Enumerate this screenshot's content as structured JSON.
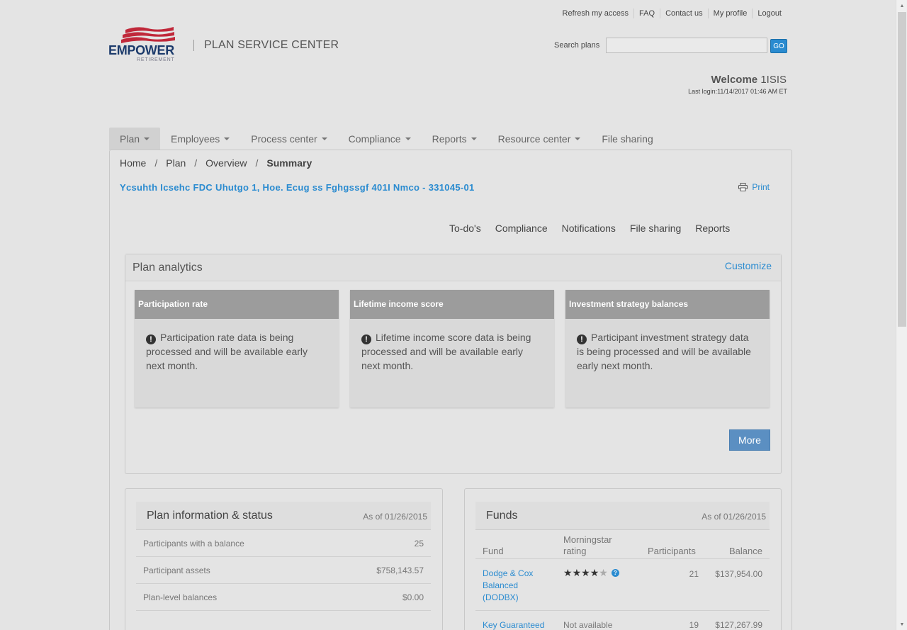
{
  "utility": {
    "links": [
      "Refresh my access",
      "FAQ",
      "Contact us",
      "My profile",
      "Logout"
    ]
  },
  "brand": {
    "wordmark": "EMPOWER",
    "sub": "RETIREMENT",
    "app_title": "PLAN SERVICE CENTER",
    "colors": {
      "navy": "#1b3a6b",
      "red": "#c0283a",
      "accent": "#2a8bd0"
    }
  },
  "search": {
    "label": "Search plans",
    "value": "",
    "button": "GO"
  },
  "welcome": {
    "greeting": "Welcome",
    "user": "1ISIS",
    "last_login": "Last login:11/14/2017 01:46 AM ET"
  },
  "nav": {
    "items": [
      {
        "label": "Plan",
        "dropdown": true
      },
      {
        "label": "Employees",
        "dropdown": true
      },
      {
        "label": "Process center",
        "dropdown": true
      },
      {
        "label": "Compliance",
        "dropdown": true
      },
      {
        "label": "Reports",
        "dropdown": true
      },
      {
        "label": "Resource center",
        "dropdown": true
      },
      {
        "label": "File sharing",
        "dropdown": false
      }
    ]
  },
  "breadcrumb": [
    "Home",
    "Plan",
    "Overview",
    "Summary"
  ],
  "plan_title": "Ycsuhth Icsehc FDC Uhutgo 1, Hoe. Ecug ss Fghgssgf 401I Nmco - 331045-01",
  "print_label": "Print",
  "subtabs": [
    "To-do's",
    "Compliance",
    "Notifications",
    "File sharing",
    "Reports"
  ],
  "analytics": {
    "title": "Plan analytics",
    "customize": "Customize",
    "cards": [
      {
        "title": "Participation rate",
        "body": "Participation rate data is being processed and will be available early next month."
      },
      {
        "title": "Lifetime income score",
        "body": "Lifetime income score data is being processed and will be available early next month."
      },
      {
        "title": "Investment strategy balances",
        "body": "Participant investment strategy data is being processed and will be available early next month."
      }
    ],
    "more": "More"
  },
  "plan_info": {
    "title": "Plan information & status",
    "as_of": "As of 01/26/2015",
    "rows": [
      {
        "label": "Participants with a balance",
        "value": "25"
      },
      {
        "label": "Participant assets",
        "value": "$758,143.57"
      },
      {
        "label": "Plan-level balances",
        "value": "$0.00"
      }
    ]
  },
  "funds": {
    "title": "Funds",
    "as_of": "As of 01/26/2015",
    "headers": {
      "fund": "Fund",
      "rating": "Morningstar rating",
      "participants": "Participants",
      "balance": "Balance"
    },
    "rows": [
      {
        "name": "Dodge & Cox Balanced (DODBX)",
        "rating": 4,
        "rating_max": 5,
        "rating_text": "",
        "participants": "21",
        "balance": "$137,954.00"
      },
      {
        "name": "Key Guaranteed",
        "rating": null,
        "rating_max": 5,
        "rating_text": "Not available",
        "participants": "19",
        "balance": "$127,267.99"
      }
    ]
  }
}
